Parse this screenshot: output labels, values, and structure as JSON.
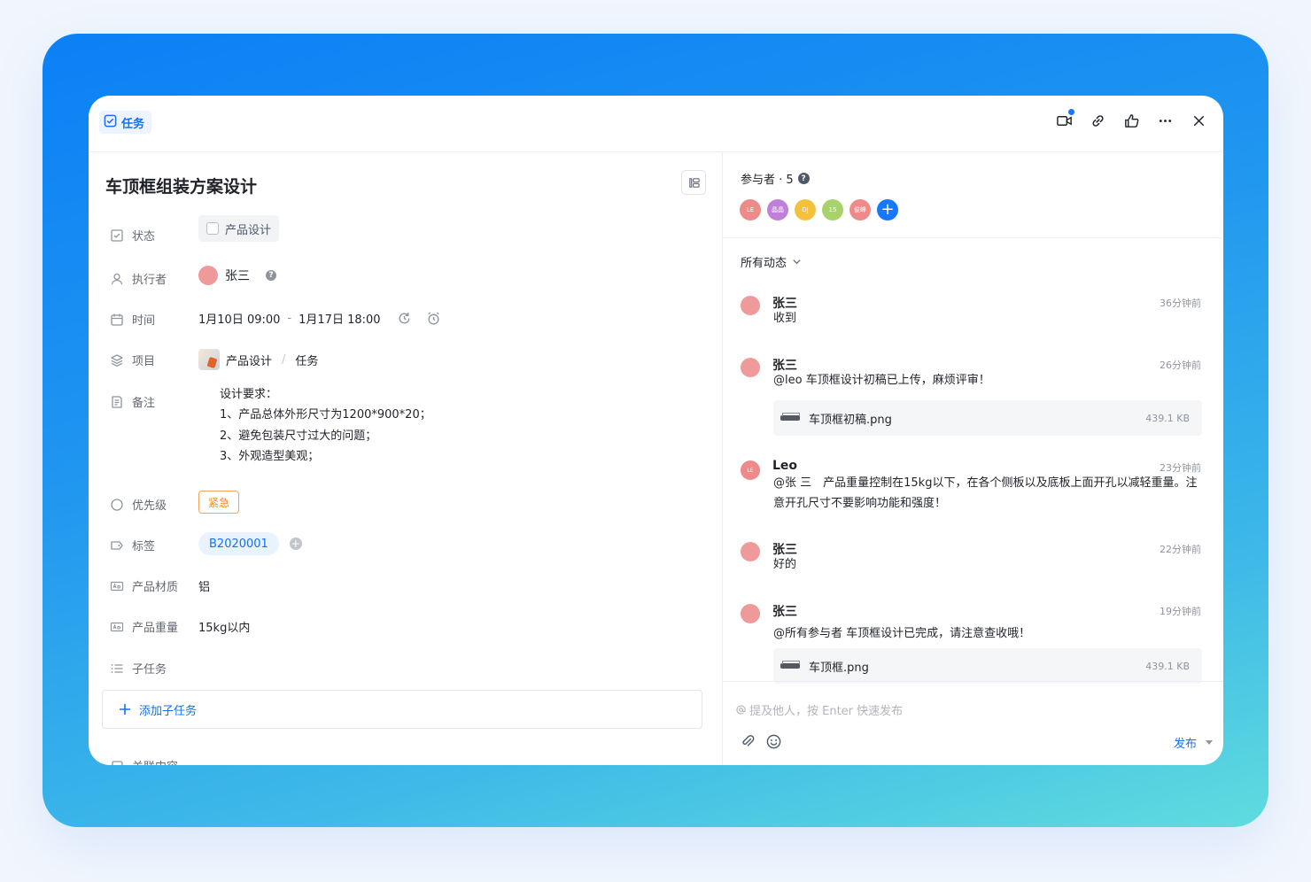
{
  "header": {
    "tag_label": "任务",
    "icons": [
      "video-icon",
      "link-icon",
      "thumbs-up-icon",
      "more-icon",
      "close-icon"
    ]
  },
  "task": {
    "title": "车顶框组装方案设计",
    "fields": {
      "status": {
        "label": "状态",
        "value": "产品设计"
      },
      "assignee": {
        "label": "执行者",
        "value": "张三"
      },
      "time": {
        "label": "时间",
        "start": "1月10日 09:00",
        "sep": "-",
        "end": "1月17日 18:00"
      },
      "project": {
        "label": "项目",
        "project": "产品设计",
        "sep": "/",
        "list": "任务"
      },
      "notes": {
        "label": "备注",
        "lines": [
          "设计要求：",
          "1、产品总体外形尺寸为1200*900*20；",
          "2、避免包装尺寸过大的问题；",
          "3、外观造型美观；"
        ]
      },
      "priority": {
        "label": "优先级",
        "value": "紧急"
      },
      "tags": {
        "label": "标签",
        "value": "B2020001"
      },
      "material": {
        "label": "产品材质",
        "value": "铝"
      },
      "weight": {
        "label": "产品重量",
        "value": "15kg以内"
      },
      "subtasks": {
        "label": "子任务"
      },
      "related": {
        "label": "关联内容"
      }
    },
    "add_subtask": "添加子任务"
  },
  "participants": {
    "title": "参与者 · 5",
    "avatars": [
      {
        "initials": "LE",
        "color": "#ef8a8a"
      },
      {
        "initials": "晶晶",
        "color": "#c07fd8"
      },
      {
        "initials": "DJ",
        "color": "#f3c13c"
      },
      {
        "initials": "15",
        "color": "#a8d36a"
      },
      {
        "initials": "俊峰",
        "color": "#ef8a8a"
      }
    ]
  },
  "activity": {
    "filter_label": "所有动态",
    "comments": [
      {
        "name": "张三",
        "time": "36分钟前",
        "text": "收到"
      },
      {
        "name": "张三",
        "time": "26分钟前",
        "text": "@leo 车顶框设计初稿已上传，麻烦评审！",
        "file": {
          "name": "车顶框初稿.png",
          "size": "439.1 KB"
        }
      },
      {
        "name": "Leo",
        "initials": "LE",
        "time": "23分钟前",
        "text": "@张 三　产品重量控制在15kg以下，在各个侧板以及底板上面开孔以减轻重量。注意开孔尺寸不要影响功能和强度！"
      },
      {
        "name": "张三",
        "time": "22分钟前",
        "text": "好的"
      },
      {
        "name": "张三",
        "time": "19分钟前",
        "text": "@所有参与者 车顶框设计已完成，请注意查收哦！",
        "file": {
          "name": "车顶框.png",
          "size": "439.1 KB"
        }
      }
    ]
  },
  "composer": {
    "placeholder": "提及他人，按 Enter 快速发布",
    "publish_label": "发布"
  }
}
